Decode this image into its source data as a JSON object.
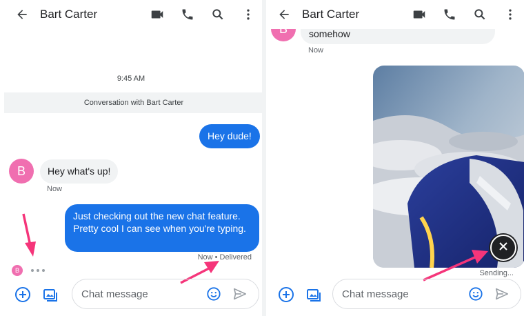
{
  "contact_name": "Bart Carter",
  "left": {
    "timestamp": "9:45 AM",
    "conversation_label": "Conversation with Bart Carter",
    "messages": [
      {
        "direction": "outgoing",
        "text": "Hey dude!"
      },
      {
        "direction": "incoming",
        "avatar_letter": "B",
        "text": "Hey what's up!",
        "meta": "Now"
      },
      {
        "direction": "outgoing",
        "text": "Just checking out the new chat feature. Pretty cool I can see when you're typing.",
        "meta": "Now • Delivered"
      }
    ],
    "typing_avatar_letter": "B"
  },
  "right": {
    "top_partial_text": "somehow",
    "top_meta": "Now",
    "avatar_letter": "B",
    "sending_label": "Sending..."
  },
  "compose": {
    "placeholder": "Chat message"
  },
  "icons": [
    "back-arrow-icon",
    "video-call-icon",
    "phone-icon",
    "search-icon",
    "more-vert-icon",
    "add-circle-icon",
    "gallery-icon",
    "emoji-icon",
    "send-icon",
    "close-icon"
  ],
  "colors": {
    "accent": "#1a73e8",
    "avatar": "#f06fb0",
    "annotation_arrow": "#f5357a",
    "bubble_incoming": "#f1f3f4"
  }
}
